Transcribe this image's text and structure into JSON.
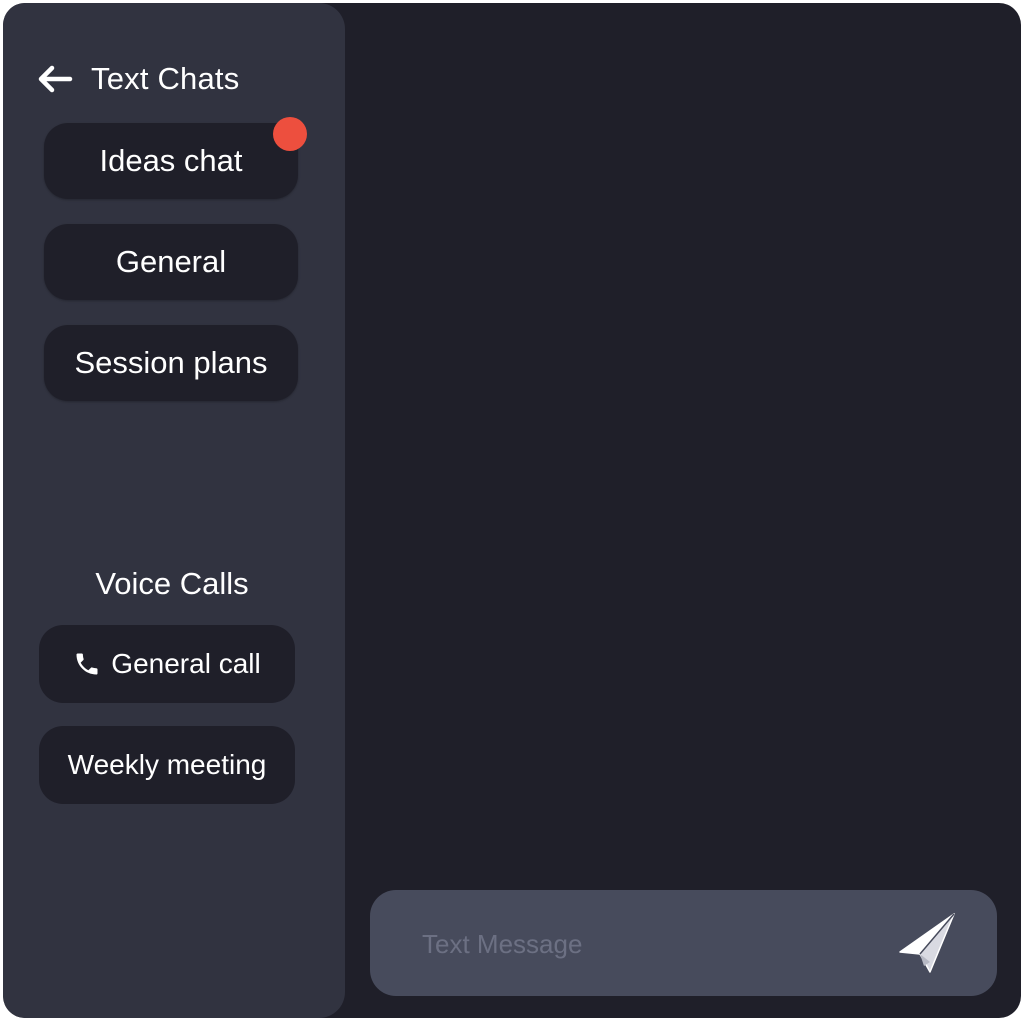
{
  "sidebar": {
    "title": "Text Chats",
    "text_channels": [
      {
        "label": "Ideas chat",
        "unread": true
      },
      {
        "label": "General",
        "unread": false
      },
      {
        "label": "Session plans",
        "unread": false
      }
    ],
    "voice_title": "Voice Calls",
    "voice_channels": [
      {
        "label": "General call",
        "icon": "phone-icon"
      },
      {
        "label": "Weekly meeting"
      }
    ]
  },
  "composer": {
    "placeholder": "Text Message",
    "value": ""
  },
  "colors": {
    "background": "#1f1f29",
    "sidebar": "#313340",
    "composer": "#474b5c",
    "unread_badge": "#ed4f3e"
  },
  "icons": {
    "back": "arrow-left-icon",
    "send": "paper-plane-icon"
  }
}
